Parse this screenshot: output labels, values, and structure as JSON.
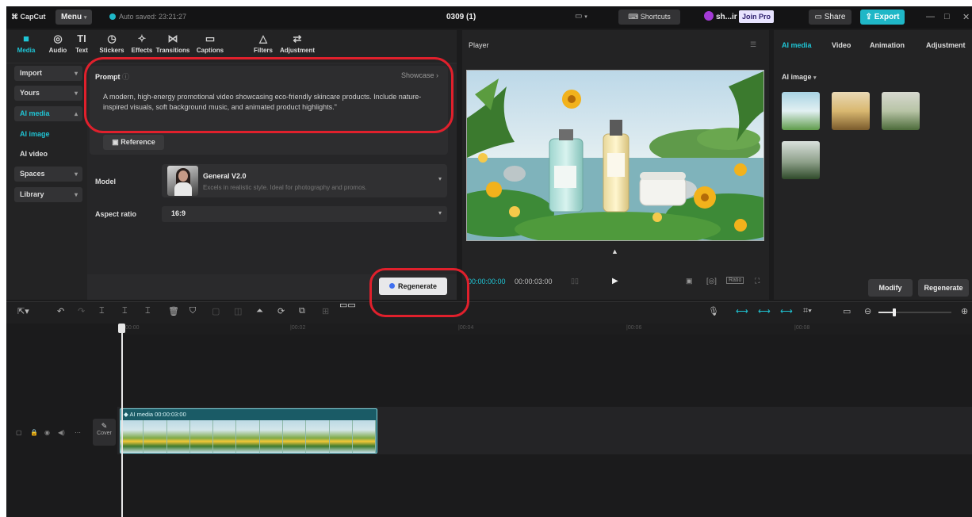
{
  "topbar": {
    "brand": "CapCut",
    "menu_label": "Menu",
    "autosave": "Auto saved: 23:21:27",
    "project_title": "0309 (1)",
    "shortcuts_label": "Shortcuts",
    "user": "sh...ir",
    "join_pro": "Join Pro",
    "share_label": "Share",
    "export_label": "Export"
  },
  "toolbar": {
    "items": [
      {
        "label": "Media",
        "icon": "media-icon"
      },
      {
        "label": "Audio",
        "icon": "audio-icon"
      },
      {
        "label": "Text",
        "icon": "text-icon"
      },
      {
        "label": "Stickers",
        "icon": "stickers-icon"
      },
      {
        "label": "Effects",
        "icon": "effects-icon"
      },
      {
        "label": "Transitions",
        "icon": "transitions-icon"
      },
      {
        "label": "Captions",
        "icon": "captions-icon"
      },
      {
        "label": "Filters",
        "icon": "filters-icon"
      },
      {
        "label": "Adjustment",
        "icon": "adjustment-icon"
      }
    ]
  },
  "sidebar": {
    "items": [
      {
        "label": "Import"
      },
      {
        "label": "Yours"
      },
      {
        "label": "AI media"
      },
      {
        "label": "AI image"
      },
      {
        "label": "AI video"
      },
      {
        "label": "Spaces"
      },
      {
        "label": "Library"
      }
    ]
  },
  "generator": {
    "prompt_label": "Prompt",
    "showcase_label": "Showcase",
    "prompt_text": "A modern, high-energy promotional video showcasing eco-friendly skincare products. Include nature-inspired visuals, soft background music, and animated product highlights.\"",
    "reference_label": "Reference",
    "model_label": "Model",
    "model_name": "General V2.0",
    "model_desc": "Excels in realistic style. Ideal for photography and promos.",
    "aspect_label": "Aspect ratio",
    "aspect_value": "16:9",
    "regenerate_label": "Regenerate"
  },
  "player": {
    "title": "Player",
    "time_current": "00:00:00:00",
    "time_total": "00:00:03:00",
    "ratio_label": "Ratio"
  },
  "right_panel": {
    "tabs": [
      "AI media",
      "Video",
      "Animation",
      "Adjustment"
    ],
    "section_label": "AI image",
    "modify_label": "Modify",
    "regenerate_label": "Regenerate"
  },
  "timeline": {
    "ticks": [
      "00:00",
      "|00:02",
      "|00:04",
      "|00:06",
      "|00:08"
    ],
    "clip_label": "AI media  00:00:03:00",
    "cover_label": "Cover"
  }
}
